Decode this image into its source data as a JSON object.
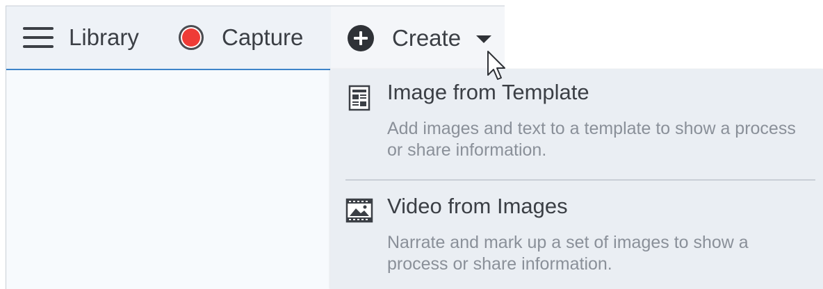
{
  "toolbar": {
    "library": {
      "label": "Library",
      "icon": "hamburger-menu-icon"
    },
    "capture": {
      "label": "Capture",
      "icon": "record-icon",
      "icon_color": "#ef3b36"
    },
    "create": {
      "label": "Create",
      "icon": "plus-circle-icon",
      "dropdown_icon": "caret-down-icon"
    }
  },
  "create_menu": {
    "items": [
      {
        "title": "Image from Template",
        "description": "Add images and text to a template to show a process or share information.",
        "icon": "template-icon"
      },
      {
        "title": "Video from Images",
        "description": "Narrate and mark up a set of images to show a process or share information.",
        "icon": "film-strip-icon"
      }
    ]
  },
  "colors": {
    "accent_underline": "#3d84c9",
    "toolbar_bg": "#eef2f7",
    "menu_bg": "#eaeef3",
    "text": "#3b3f45",
    "muted_text": "#8a9099"
  }
}
